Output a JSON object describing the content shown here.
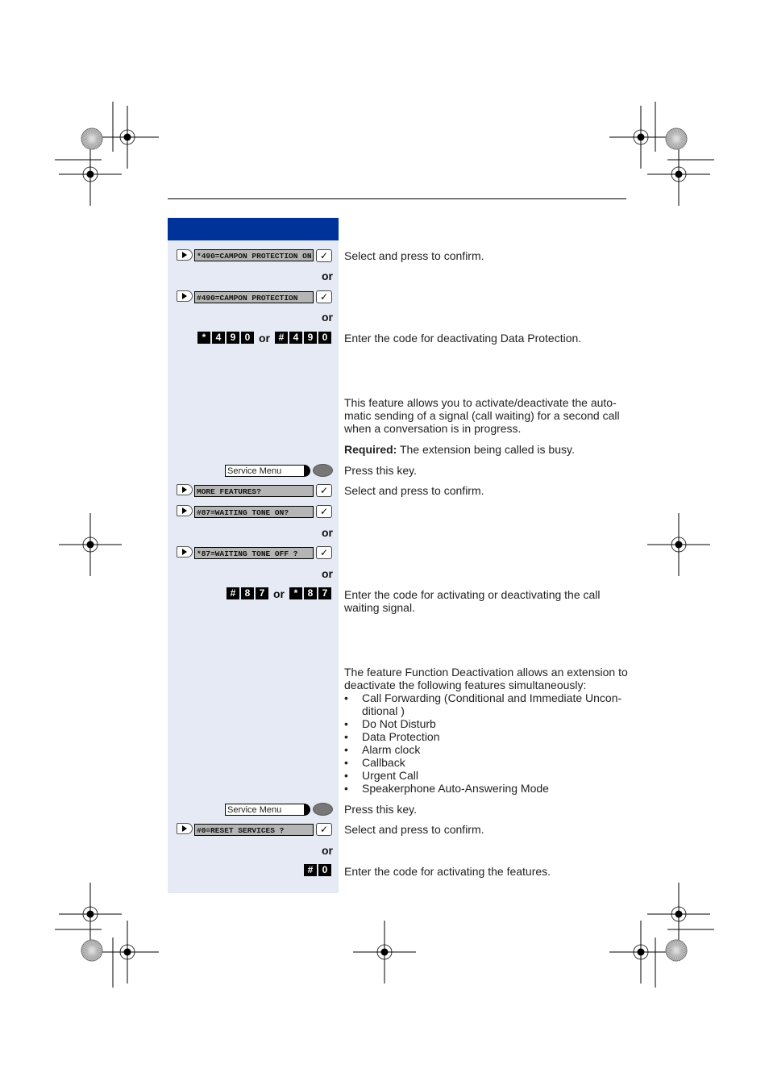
{
  "header": {
    "title": ""
  },
  "rows": {
    "r1": {
      "display": "*490=CAMPON PROTECTION ON",
      "text": "Select and press to confirm."
    },
    "or1": "or",
    "r2": {
      "display": "#490=CAMPON PROTECTION"
    },
    "or2": "or",
    "r3": {
      "keys_a": [
        "*",
        "4",
        "9",
        "0"
      ],
      "or": "or",
      "keys_b": [
        "#",
        "4",
        "9",
        "0"
      ],
      "text": "Enter the code for deactivating Data Protection."
    },
    "intro1": "This feature allows you to activate/deactivate the auto-matic sending of a signal (call waiting) for a second call when a conversation is in progress.",
    "required_label": "Required:",
    "required_text": " The extension being called is busy.",
    "svc1": {
      "label": "Service Menu",
      "text": "Press this key."
    },
    "r4": {
      "display": "MORE FEATURES?",
      "text": "Select and press to confirm."
    },
    "r5": {
      "display": "#87=WAITING TONE ON?"
    },
    "or3": "or",
    "r6": {
      "display": "*87=WAITING TONE OFF ?"
    },
    "or4": "or",
    "r7": {
      "keys_a": [
        "#",
        "8",
        "7"
      ],
      "or": "or",
      "keys_b": [
        "*",
        "8",
        "7"
      ],
      "text": "Enter the code for activating or deactivating the call waiting signal."
    },
    "intro2": "The feature Function Deactivation allows an extension to deactivate the following features simultaneously:",
    "bullets": [
      "Call Forwarding (Conditional and Immediate Uncon-",
      "ditional )",
      "Do Not Disturb",
      "Data Protection",
      "Alarm clock",
      "Callback",
      "Urgent Call",
      "Speakerphone Auto-Answering Mode"
    ],
    "bullet_char": "•",
    "svc2": {
      "label": "Service Menu",
      "text": "Press this key."
    },
    "r8": {
      "display": "#0=RESET SERVICES ?",
      "text": "Select and press to confirm."
    },
    "or5": "or",
    "r9": {
      "keys": [
        "#",
        "0"
      ],
      "text": "Enter the code for activating the features."
    }
  },
  "icons": {
    "check": "✓"
  },
  "colors": {
    "accent": "#003399",
    "column_bg": "#e6eaf4"
  }
}
